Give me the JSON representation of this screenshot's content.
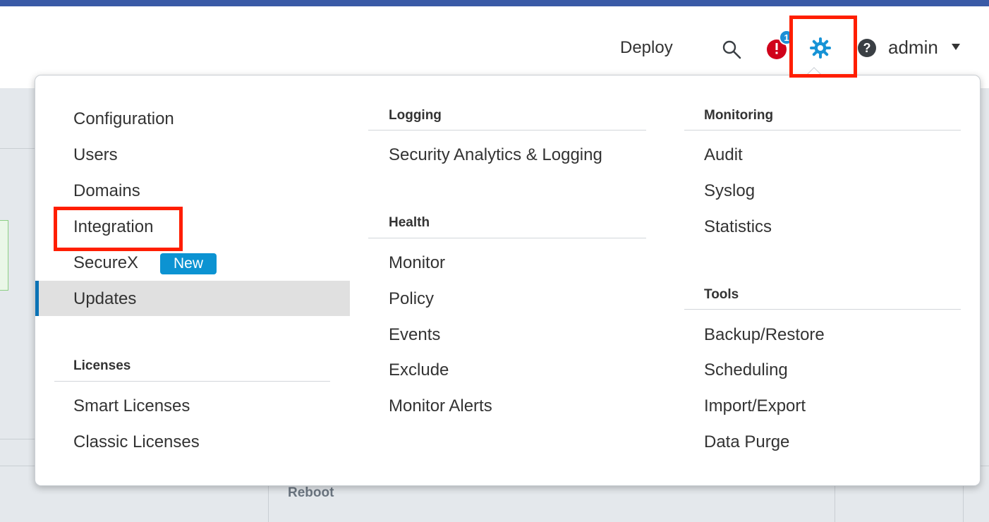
{
  "header": {
    "deploy_label": "Deploy",
    "alert_count": "1",
    "help_label": "?",
    "user_label": "admin",
    "icons": [
      "search-icon",
      "alert-icon",
      "gear-icon",
      "help-icon",
      "caret-down-icon"
    ]
  },
  "background": {
    "reboot_label": "Reboot"
  },
  "menu": {
    "col1": {
      "items": [
        "Configuration",
        "Users",
        "Domains",
        "Integration",
        "SecureX",
        "Updates"
      ],
      "securex_badge": "New",
      "licenses_heading": "Licenses",
      "licenses_items": [
        "Smart Licenses",
        "Classic Licenses"
      ]
    },
    "col2": {
      "logging_heading": "Logging",
      "logging_items": [
        "Security Analytics & Logging"
      ],
      "health_heading": "Health",
      "health_items": [
        "Monitor",
        "Policy",
        "Events",
        "Exclude",
        "Monitor Alerts"
      ]
    },
    "col3": {
      "monitoring_heading": "Monitoring",
      "monitoring_items": [
        "Audit",
        "Syslog",
        "Statistics"
      ],
      "tools_heading": "Tools",
      "tools_items": [
        "Backup/Restore",
        "Scheduling",
        "Import/Export",
        "Data Purge"
      ]
    }
  },
  "colors": {
    "accent_blue": "#0c93d2",
    "highlight_red": "#ff1e00",
    "alert_red": "#d0021b",
    "selected_bar": "#0a72b5"
  }
}
